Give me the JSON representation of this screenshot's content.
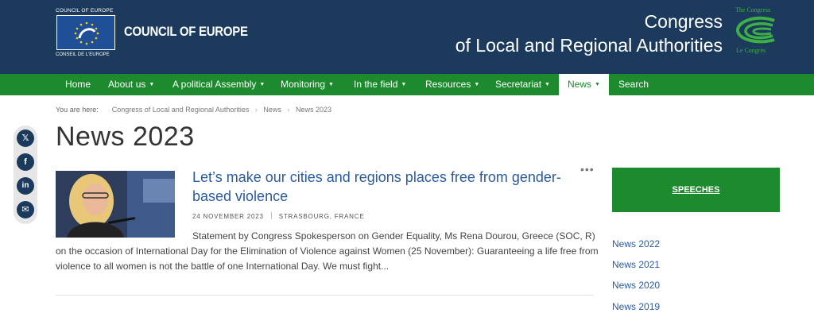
{
  "header": {
    "coe_top": "COUNCIL OF EUROPE",
    "coe_name": "COUNCIL OF EUROPE",
    "coe_bottom": "CONSEIL DE L'EUROPE",
    "congress_line1": "Congress",
    "congress_line2": "of Local and Regional Authorities",
    "congress_logo_top": "The Congress",
    "congress_logo_bottom": "Le Congrès"
  },
  "nav": {
    "items": [
      {
        "label": "Home"
      },
      {
        "label": "About us",
        "caret": "▼"
      },
      {
        "label": "A political Assembly",
        "caret": "▼"
      },
      {
        "label": "Monitoring",
        "caret": "▼"
      },
      {
        "label": "In the field",
        "caret": "▼"
      },
      {
        "label": "Resources",
        "caret": "▼"
      },
      {
        "label": "Secretariat",
        "caret": "▼"
      },
      {
        "label": "News",
        "caret": "▼"
      },
      {
        "label": "Search"
      }
    ]
  },
  "breadcrumb": {
    "prefix": "You are here:",
    "items": [
      "Congress of Local and Regional Authorities",
      "News",
      "News 2023"
    ],
    "sep": "›"
  },
  "page_title": "News 2023",
  "social": {
    "icons": [
      {
        "name": "x-twitter-icon",
        "glyph": "𝕏"
      },
      {
        "name": "facebook-icon",
        "glyph": "f"
      },
      {
        "name": "linkedin-icon",
        "glyph": "in"
      },
      {
        "name": "email-icon",
        "glyph": "✉"
      }
    ]
  },
  "article": {
    "title": "Let’s make our cities and regions places free from gender-based violence",
    "more": "•••",
    "date": "24 NOVEMBER 2023",
    "location": "STRASBOURG, FRANCE",
    "summary_first": "Statement by Congress Spokesperson on Gender Equality, Ms Rena Dourou, Greece (SOC, R)",
    "summary_rest": "on the occasion of International Day for the Elimination of Violence against Women (25 November): Guaranteeing a life free from violence to all women is not the battle of one International Day. We must fight..."
  },
  "sidebar": {
    "speeches": "SPEECHES",
    "years": [
      "News 2022",
      "News 2021",
      "News 2020",
      "News 2019"
    ]
  },
  "colors": {
    "header_bg": "#1b3a5c",
    "nav_green": "#1e8a2e",
    "link_blue": "#2a5b9e"
  }
}
